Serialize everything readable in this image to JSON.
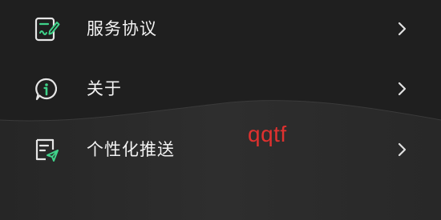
{
  "menu": {
    "items": [
      {
        "label": "服务协议",
        "icon": "agreement-document-icon"
      },
      {
        "label": "关于",
        "icon": "info-icon"
      },
      {
        "label": "个性化推送",
        "icon": "push-settings-icon"
      }
    ],
    "chevron_icon": "chevron-right-icon"
  },
  "overlay_text": "qqtf",
  "colors": {
    "background": "#1e1e1e",
    "label": "#f2f2f2",
    "icon_outline": "#e6e6e6",
    "icon_accent": "#3fd38a",
    "chevron": "#e0e0e0",
    "overlay_text": "#e0312f"
  }
}
